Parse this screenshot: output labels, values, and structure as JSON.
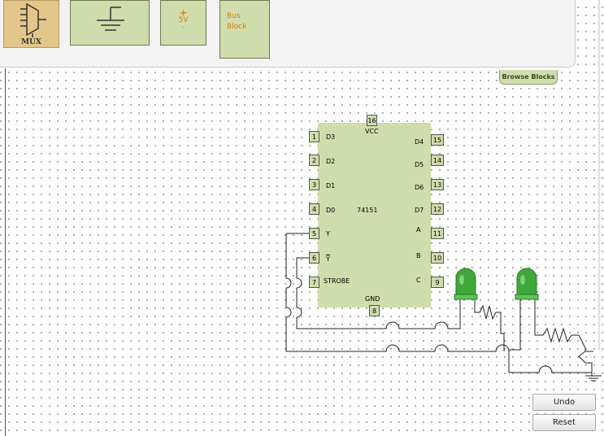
{
  "toolbar": {
    "blocks": {
      "mux": "MUX",
      "v5_plus": "+",
      "v5_value": "5V",
      "v5_minus": "-",
      "bus": "Bus\nBlock"
    },
    "browse_label": "Browse Blocks"
  },
  "chip": {
    "name": "74151",
    "top_pin": {
      "num": "16",
      "label": "VCC"
    },
    "bottom_pin": {
      "num": "8",
      "label": "GND"
    },
    "left_pins": [
      {
        "num": "1",
        "label": "D3"
      },
      {
        "num": "2",
        "label": "D2"
      },
      {
        "num": "3",
        "label": "D1"
      },
      {
        "num": "4",
        "label": "D0"
      },
      {
        "num": "5",
        "label": "Y"
      },
      {
        "num": "6",
        "label": "Y"
      },
      {
        "num": "7",
        "label": "STROBE"
      }
    ],
    "right_pins": [
      {
        "num": "15",
        "label": "D4"
      },
      {
        "num": "14",
        "label": "D5"
      },
      {
        "num": "13",
        "label": "D6"
      },
      {
        "num": "12",
        "label": "D7"
      },
      {
        "num": "11",
        "label": "A"
      },
      {
        "num": "10",
        "label": "B"
      },
      {
        "num": "9",
        "label": "C"
      }
    ]
  },
  "buttons": {
    "undo": "Undo",
    "reset": "Reset"
  },
  "colors": {
    "block": "#cfdcab",
    "led": "#3fa83a",
    "accent_text": "#e07a00"
  }
}
